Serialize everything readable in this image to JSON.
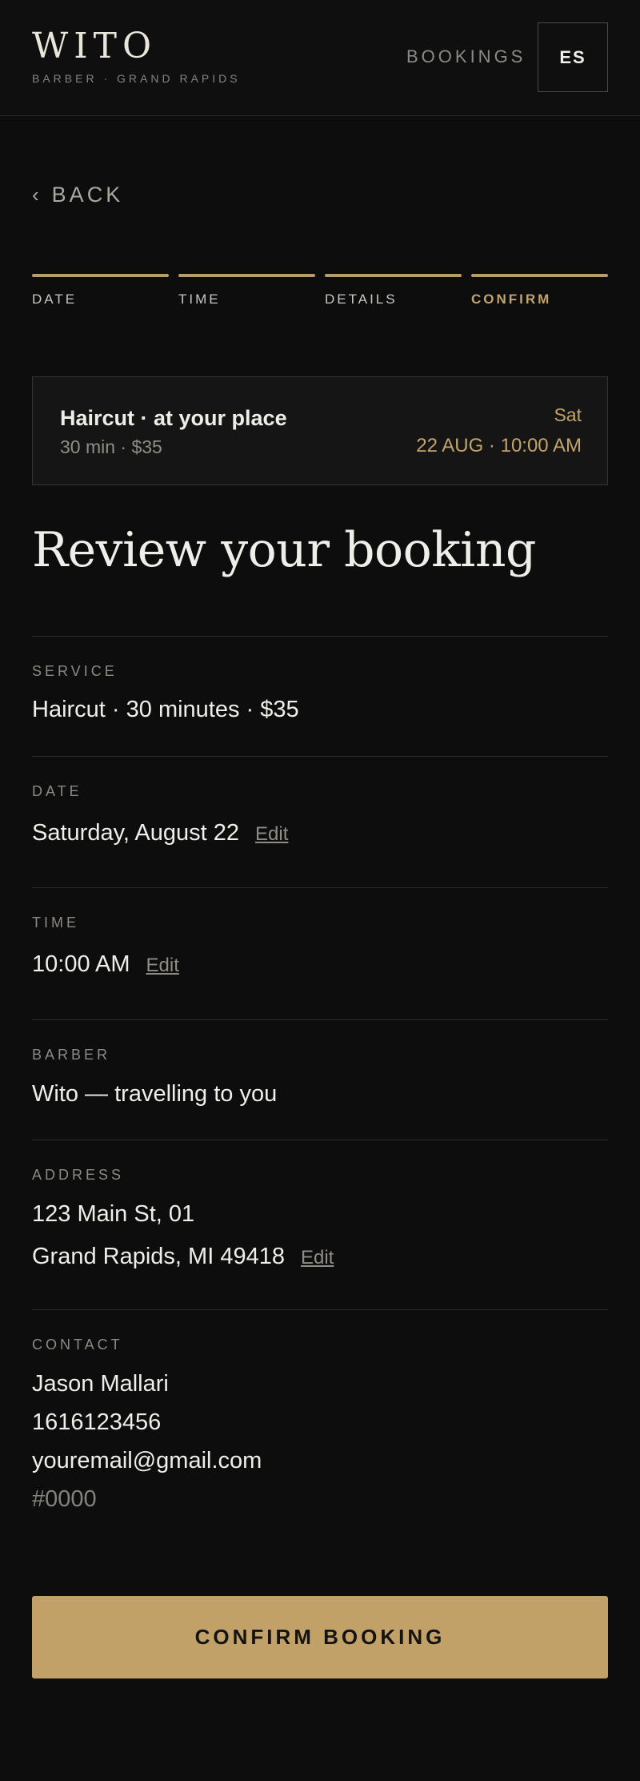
{
  "header": {
    "brand_name": "WITO",
    "brand_sub": "BARBER · GRAND RAPIDS",
    "nav_bookings": "BOOKINGS",
    "lang_toggle": "ES"
  },
  "back_label": "BACK",
  "steps": [
    {
      "label": "DATE"
    },
    {
      "label": "TIME"
    },
    {
      "label": "DETAILS"
    },
    {
      "label": "CONFIRM"
    }
  ],
  "summary": {
    "service": "Haircut · at your place",
    "meta": "30 min · $35",
    "day": "Sat",
    "datetime": "22 AUG · 10:00 AM"
  },
  "title": "Review your booking",
  "sections": {
    "service": {
      "label": "SERVICE",
      "value": "Haircut · 30 minutes · $35"
    },
    "date": {
      "label": "DATE",
      "value": "Saturday, August 22",
      "edit": "Edit"
    },
    "time": {
      "label": "TIME",
      "value": "10:00 AM",
      "edit": "Edit"
    },
    "barber": {
      "label": "BARBER",
      "value": "Wito — travelling to you"
    },
    "address": {
      "label": "ADDRESS",
      "line1": "123 Main St, 01",
      "line2": "Grand Rapids, MI 49418",
      "edit": "Edit"
    },
    "contact": {
      "label": "CONTACT",
      "name": "Jason Mallari",
      "phone": "1616123456",
      "email": "youremail@gmail.com",
      "code": "#0000"
    }
  },
  "confirm_label": "CONFIRM BOOKING",
  "colors": {
    "accent": "#c1a167",
    "background": "#0c0d0c",
    "text": "#efeee9"
  }
}
